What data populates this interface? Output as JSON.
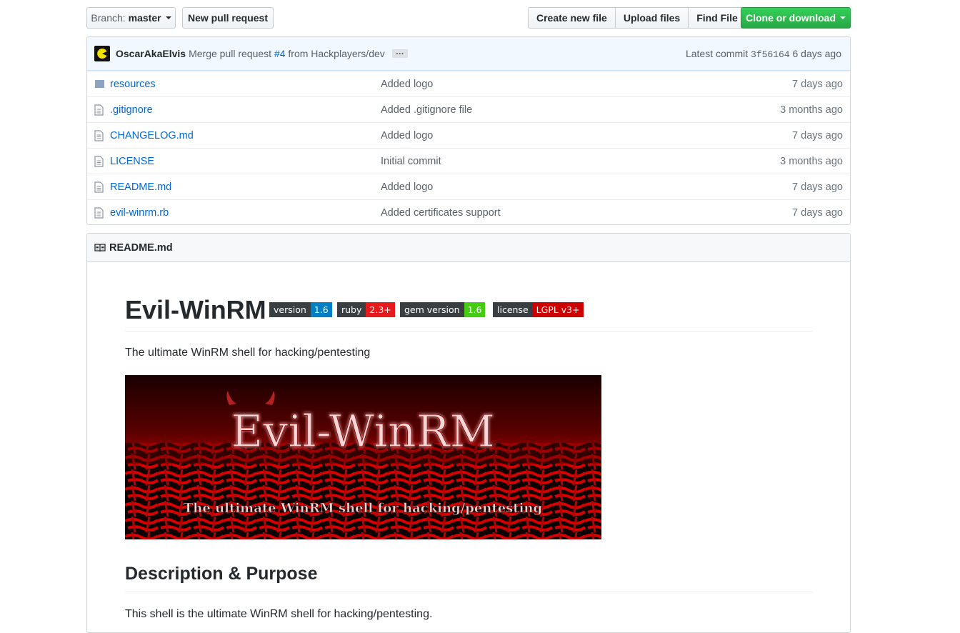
{
  "toolbar": {
    "branch_prefix": "Branch:",
    "branch_name": "master",
    "new_pull_request": "New pull request",
    "create_new_file": "Create new file",
    "upload_files": "Upload files",
    "find_file": "Find File",
    "clone_or_download": "Clone or download"
  },
  "commit": {
    "author": "OscarAkaElvis",
    "message_prefix": "Merge pull request",
    "pr_number": "#4",
    "message_suffix": "from Hackplayers/dev",
    "ellipsis": "…",
    "latest_label": "Latest commit",
    "sha": "3f56164",
    "age": "6 days ago"
  },
  "files": [
    {
      "type": "folder",
      "name": "resources",
      "message": "Added logo",
      "age": "7 days ago"
    },
    {
      "type": "file",
      "name": ".gitignore",
      "message": "Added .gitignore file",
      "age": "3 months ago"
    },
    {
      "type": "file",
      "name": "CHANGELOG.md",
      "message": "Added logo",
      "age": "7 days ago"
    },
    {
      "type": "file",
      "name": "LICENSE",
      "message": "Initial commit",
      "age": "3 months ago"
    },
    {
      "type": "file",
      "name": "README.md",
      "message": "Added logo",
      "age": "7 days ago"
    },
    {
      "type": "file",
      "name": "evil-winrm.rb",
      "message": "Added certificates support",
      "age": "7 days ago"
    }
  ],
  "readme": {
    "header": "README.md",
    "title": "Evil-WinRM",
    "badges": [
      {
        "label": "version",
        "value": "1.6",
        "color": "#007ec6"
      },
      {
        "label": "ruby",
        "value": "2.3+",
        "color": "#e41a1c"
      },
      {
        "label": "gem version",
        "value": "1.6",
        "color": "#4c1"
      },
      {
        "label": "license",
        "value": "LGPL v3+",
        "color": "#c00"
      }
    ],
    "tagline": "The ultimate WinRM shell for hacking/pentesting",
    "banner_title": "Evil-WinRM",
    "banner_subtitle": "The ultimate WinRM shell for hacking/pentesting",
    "section_heading": "Description & Purpose",
    "section_text": "This shell is the ultimate WinRM shell for hacking/pentesting."
  },
  "colors": {
    "link": "#0366d6",
    "green_button": "#28a745",
    "commit_bar": "#f1f8ff"
  }
}
